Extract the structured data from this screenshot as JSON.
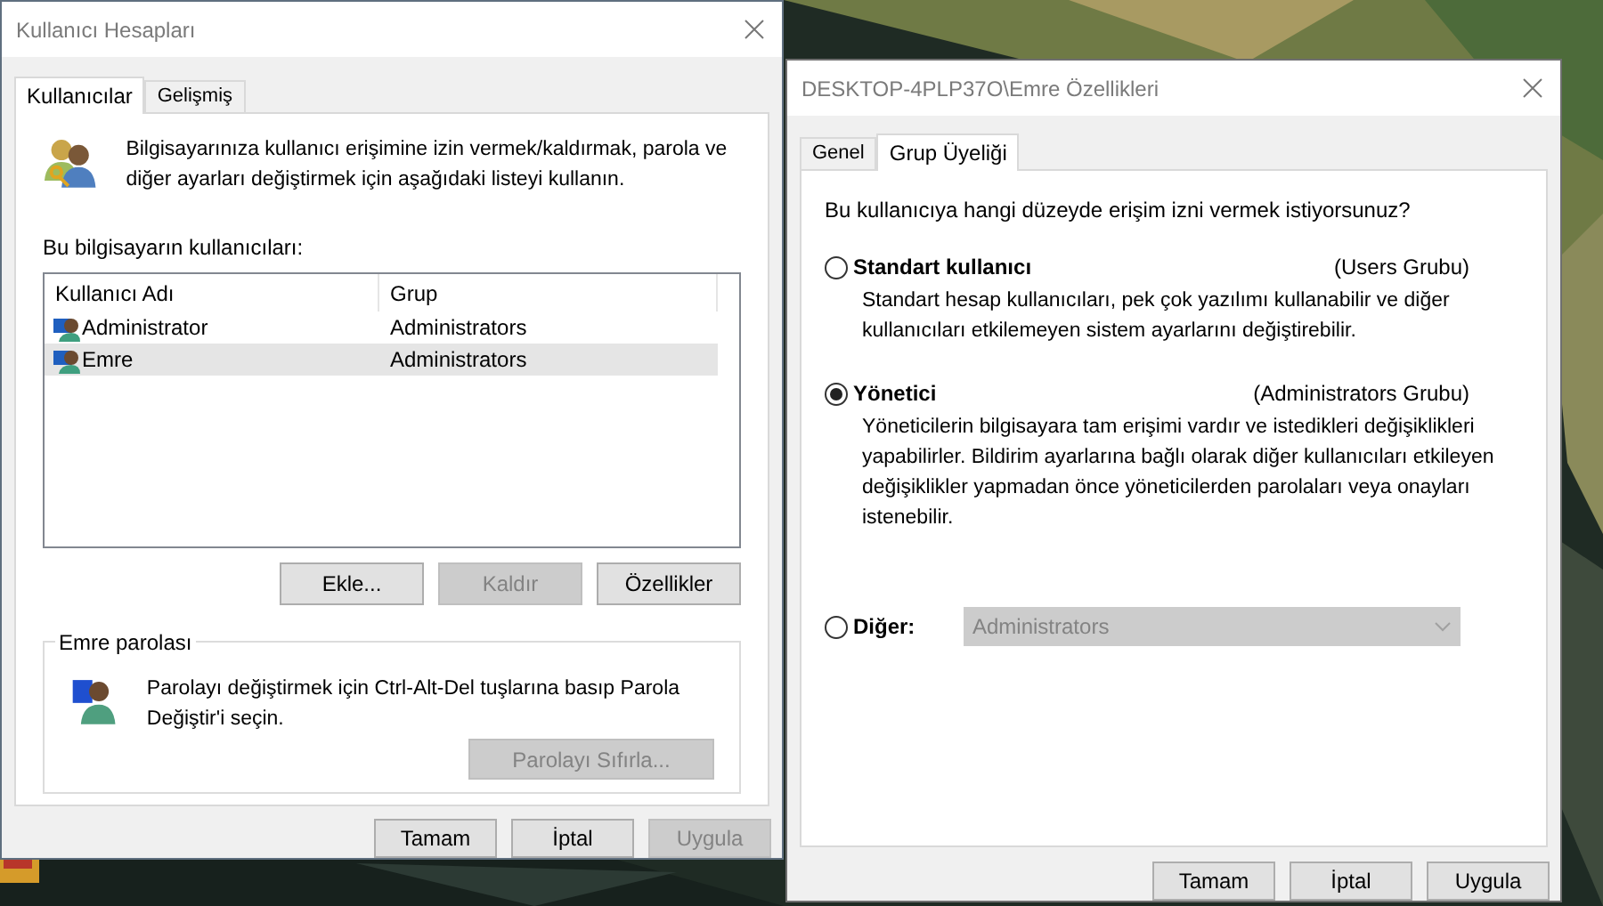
{
  "accounts_window": {
    "title": "Kullanıcı Hesapları",
    "tabs": [
      {
        "label": "Kullanıcılar",
        "selected": true
      },
      {
        "label": "Gelişmiş",
        "selected": false
      }
    ],
    "intro_text": "Bilgisayarınıza kullanıcı erişimine izin vermek/kaldırmak, parola ve diğer ayarları değiştirmek için aşağıdaki listeyi kullanın.",
    "list_label": "Bu bilgisayarın kullanıcıları:",
    "table": {
      "columns": [
        "Kullanıcı Adı",
        "Grup"
      ],
      "rows": [
        {
          "cells": [
            "Administrator",
            "Administrators"
          ],
          "selected": false
        },
        {
          "cells": [
            "Emre",
            "Administrators"
          ],
          "selected": true
        }
      ]
    },
    "list_buttons": [
      {
        "label": "Ekle...",
        "disabled": false
      },
      {
        "label": "Kaldır",
        "disabled": true
      },
      {
        "label": "Özellikler",
        "disabled": false
      }
    ],
    "password_group": {
      "title": "Emre parolası",
      "text": "Parolayı değiştirmek için Ctrl-Alt-Del tuşlarına basıp Parola Değiştir'i seçin.",
      "button": {
        "label": "Parolayı Sıfırla...",
        "disabled": true
      }
    },
    "dialog_buttons": [
      {
        "label": "Tamam",
        "disabled": false
      },
      {
        "label": "İptal",
        "disabled": false
      },
      {
        "label": "Uygula",
        "disabled": true
      }
    ]
  },
  "properties_window": {
    "title": "DESKTOP-4PLP37O\\Emre Özellikleri",
    "tabs": [
      {
        "label": "Genel",
        "selected": false
      },
      {
        "label": "Grup Üyeliği",
        "selected": true
      }
    ],
    "question": "Bu kullanıcıya hangi düzeyde erişim izni vermek istiyorsunuz?",
    "options": [
      {
        "kind": "description",
        "label": "Standart kullanıcı",
        "group": "(Users Grubu)",
        "description": "Standart hesap kullanıcıları, pek çok yazılımı kullanabilir ve diğer kullanıcıları etkilemeyen sistem ayarlarını değiştirebilir.",
        "selected": false
      },
      {
        "kind": "description",
        "label": "Yönetici",
        "group": "(Administrators Grubu)",
        "description": "Yöneticilerin bilgisayara tam erişimi vardır ve istedikleri değişiklikleri yapabilirler. Bildirim ayarlarına bağlı olarak diğer kullanıcıları etkileyen değişiklikler yapmadan önce yöneticilerden parolaları veya onayları istenebilir.",
        "selected": true
      },
      {
        "kind": "dropdown",
        "label": "Diğer:",
        "value": "Administrators",
        "disabled": true,
        "selected": false
      }
    ],
    "dialog_buttons": [
      {
        "label": "Tamam",
        "disabled": false
      },
      {
        "label": "İptal",
        "disabled": false
      },
      {
        "label": "Uygula",
        "disabled": false
      }
    ]
  }
}
